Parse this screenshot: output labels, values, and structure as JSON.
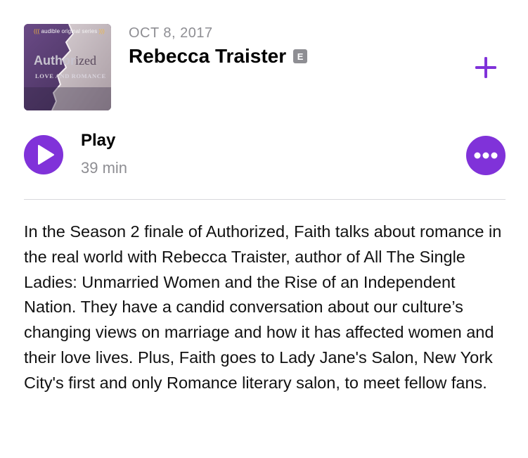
{
  "episode": {
    "artwork": {
      "series_label": "audible original series",
      "title_part1": "Author",
      "title_part2": "ized",
      "subtitle": "LOVE AND ROMANCE"
    },
    "date": "OCT 8, 2017",
    "title": "Rebecca Traister",
    "explicit_badge": "E",
    "add_icon": "plus-icon",
    "play_label": "Play",
    "duration": "39 min",
    "more_icon": "ellipsis-icon",
    "description": "In the Season 2 finale of Authorized, Faith talks about romance in the real world with Rebecca Traister, author of All The Single Ladies: Unmarried Women and the Rise of an Independent Nation. They have a candid conversation about our culture’s changing views on marriage and how it has affected women and their love lives. Plus, Faith goes to Lady Jane's Salon, New York City's first and only Romance literary salon, to meet fellow fans."
  },
  "colors": {
    "accent": "#8032d9",
    "secondary_text": "#8e8e93",
    "divider": "#d8d8dc"
  }
}
